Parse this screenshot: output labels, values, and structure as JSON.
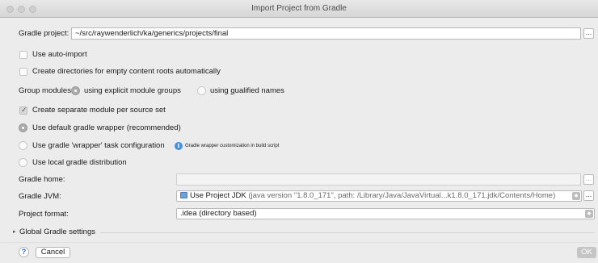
{
  "window": {
    "title": "Import Project from Gradle"
  },
  "gradle_project": {
    "label": "Gradle project:",
    "value": "~/src/raywenderlich/ka/generics/projects/final",
    "browse": "..."
  },
  "options": {
    "auto_import": "Use auto-import",
    "create_dirs": "Create directories for empty content roots automatically"
  },
  "group_modules": {
    "label": "Group modules:",
    "explicit": "using explicit module groups",
    "qualified_pre": "using ",
    "qualified_u": "q",
    "qualified_post": "ualified names"
  },
  "separate_module": "Create separate module per source set",
  "wrapper": {
    "default": "Use default gradle wrapper (recommended)",
    "task": "Use gradle 'wrapper' task configuration",
    "task_hint": "Gradle wrapper customization in build script",
    "local": "Use local gradle distribution"
  },
  "gradle_home": {
    "label": "Gradle home:",
    "value": "",
    "browse": "..."
  },
  "gradle_jvm": {
    "label": "Gradle JVM:",
    "value_main": "Use Project JDK",
    "value_detail": "(java version \"1.8.0_171\", path: /Library/Java/JavaVirtual...k1.8.0_171.jdk/Contents/Home)",
    "browse": "..."
  },
  "project_format": {
    "label": "Project format:",
    "value": ".idea (directory based)"
  },
  "global_settings": {
    "label": "Global Gradle settings"
  },
  "buttons": {
    "help": "?",
    "cancel": "Cancel",
    "ok": "OK"
  }
}
